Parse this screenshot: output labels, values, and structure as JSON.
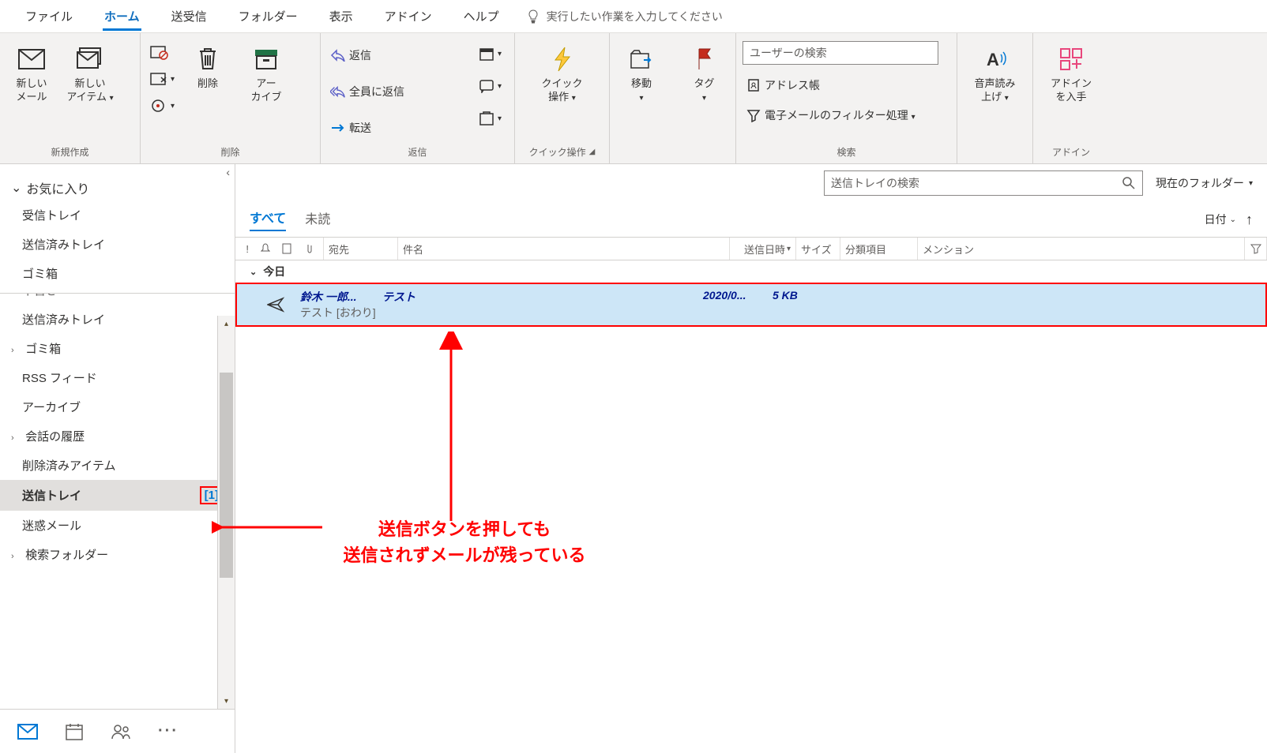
{
  "menu": {
    "file": "ファイル",
    "home": "ホーム",
    "sendrecv": "送受信",
    "folder": "フォルダー",
    "view": "表示",
    "addin": "アドイン",
    "help": "ヘルプ",
    "tellme": "実行したい作業を入力してください"
  },
  "ribbon": {
    "new_mail": "新しい\nメール",
    "new_item": "新しい\nアイテム",
    "group_new": "新規作成",
    "delete": "削除",
    "archive": "アー\nカイブ",
    "group_delete": "削除",
    "reply": "返信",
    "reply_all": "全員に返信",
    "forward": "転送",
    "group_reply": "返信",
    "quick": "クイック\n操作",
    "group_quick": "クイック操作",
    "move": "移動",
    "tag": "タグ",
    "search_placeholder": "ユーザーの検索",
    "address_book": "アドレス帳",
    "filter_email": "電子メールのフィルター処理",
    "group_search": "検索",
    "read_aloud": "音声読み\n上げ",
    "get_addins": "アドイン\nを入手",
    "group_addin": "アドイン"
  },
  "sidebar": {
    "favorites": "お気に入り",
    "inbox": "受信トレイ",
    "sent": "送信済みトレイ",
    "trash": "ゴミ箱",
    "clipped": "下書き",
    "sent2": "送信済みトレイ",
    "trash2": "ゴミ箱",
    "rss": "RSS フィード",
    "archive": "アーカイブ",
    "conv": "会話の履歴",
    "deleted": "削除済みアイテム",
    "outbox": "送信トレイ",
    "outbox_count": "[1]",
    "junk": "迷惑メール",
    "search_folders": "検索フォルダー"
  },
  "content": {
    "search_placeholder": "送信トレイの検索",
    "scope": "現在のフォルダー",
    "tab_all": "すべて",
    "tab_unread": "未読",
    "sort_date": "日付",
    "col_to": "宛先",
    "col_subject": "件名",
    "col_date": "送信日時",
    "col_size": "サイズ",
    "col_cat": "分類項目",
    "col_mention": "メンション",
    "group_today": "今日",
    "mail": {
      "recipient": "鈴木 一郎...",
      "subject": "テスト",
      "date": "2020/0...",
      "size": "5 KB",
      "preview": "テスト [おわり]"
    }
  },
  "annotation": {
    "text_line1": "送信ボタンを押しても",
    "text_line2": "送信されずメールが残っている"
  }
}
